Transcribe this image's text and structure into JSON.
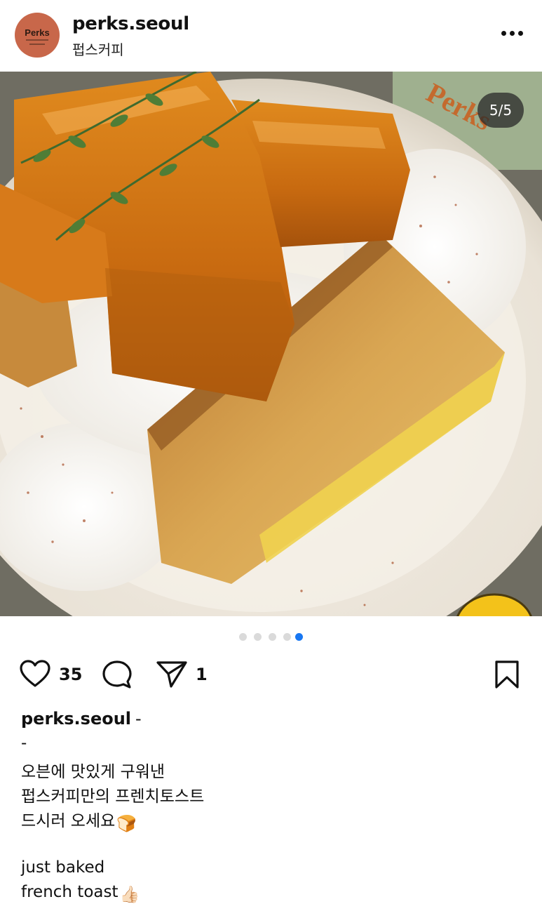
{
  "header": {
    "avatar_text": "Perks",
    "username": "perks.seoul",
    "location": "펍스커피",
    "more_icon": "more-horizontal-icon"
  },
  "carousel": {
    "counter": "5/5",
    "current_index": 5,
    "total": 5,
    "photo_description": "french-toast-with-caramelized-banana",
    "plate_brand": "Perks"
  },
  "actions": {
    "like_icon": "heart-icon",
    "like_count": "35",
    "comment_icon": "comment-icon",
    "share_icon": "send-icon",
    "share_count": "1",
    "save_icon": "bookmark-icon"
  },
  "caption": {
    "username": "perks.seoul",
    "dash": "-",
    "lines": [
      "-",
      "오븐에 맛있게 구워낸",
      "펍스커피만의 프렌치토스트",
      "드시러 오세요",
      "",
      "just baked",
      "french toast"
    ],
    "bread_emoji": "🍞",
    "thumbs_emoji": "👍🏻"
  },
  "colors": {
    "accent_blue": "#1877f2",
    "text": "#111111",
    "avatar_bg": "#c8674a"
  }
}
